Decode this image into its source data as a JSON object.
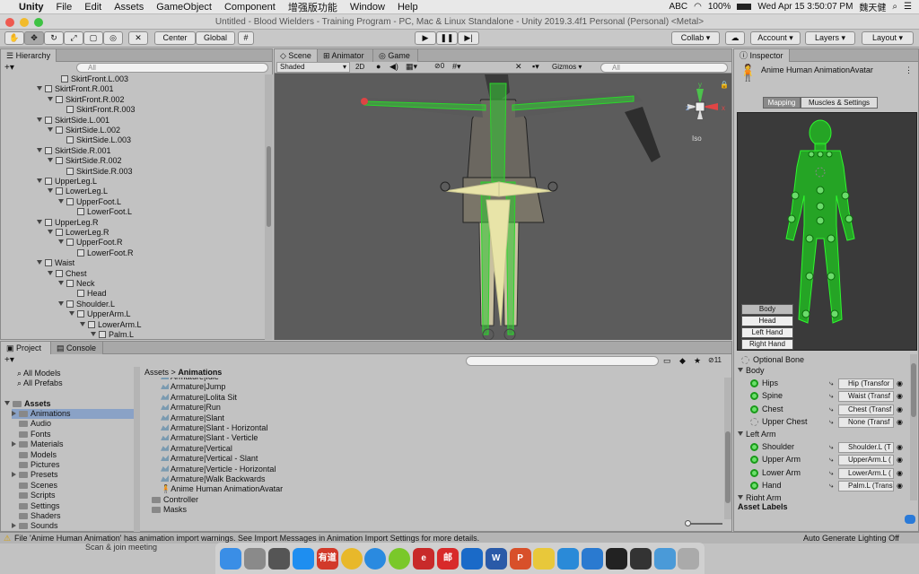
{
  "macbar": {
    "apple": "",
    "app": "Unity",
    "menus": [
      "File",
      "Edit",
      "Assets",
      "GameObject",
      "Component",
      "增强版功能",
      "Window",
      "Help"
    ],
    "abc": "ABC",
    "battery": "100%",
    "clock": "Wed Apr 15  3:50:07 PM",
    "user": "魏天健"
  },
  "titlebar": {
    "text": "Untitled - Blood Wielders - Training Program - PC, Mac & Linux Standalone - Unity 2019.3.4f1 Personal (Personal) <Metal>"
  },
  "toolbar": {
    "center": "Center",
    "global": "Global",
    "collab": "Collab ▾",
    "account": "Account ▾",
    "layers": "Layers ▾",
    "layout": "Layout ▾"
  },
  "hierarchy": {
    "tab": "Hierarchy",
    "create": "+▾",
    "search": "All",
    "rows": [
      {
        "label": "SkirtFront.L.003",
        "indent": 10,
        "arrow": false
      },
      {
        "label": "SkirtFront.R.001",
        "indent": 7,
        "arrow": true
      },
      {
        "label": "SkirtFront.R.002",
        "indent": 9,
        "arrow": true
      },
      {
        "label": "SkirtFront.R.003",
        "indent": 11,
        "arrow": false
      },
      {
        "label": "SkirtSide.L.001",
        "indent": 7,
        "arrow": true
      },
      {
        "label": "SkirtSide.L.002",
        "indent": 9,
        "arrow": true
      },
      {
        "label": "SkirtSide.L.003",
        "indent": 11,
        "arrow": false
      },
      {
        "label": "SkirtSide.R.001",
        "indent": 7,
        "arrow": true
      },
      {
        "label": "SkirtSide.R.002",
        "indent": 9,
        "arrow": true
      },
      {
        "label": "SkirtSide.R.003",
        "indent": 11,
        "arrow": false
      },
      {
        "label": "UpperLeg.L",
        "indent": 7,
        "arrow": true
      },
      {
        "label": "LowerLeg.L",
        "indent": 9,
        "arrow": true
      },
      {
        "label": "UpperFoot.L",
        "indent": 11,
        "arrow": true
      },
      {
        "label": "LowerFoot.L",
        "indent": 13,
        "arrow": false
      },
      {
        "label": "UpperLeg.R",
        "indent": 7,
        "arrow": true
      },
      {
        "label": "LowerLeg.R",
        "indent": 9,
        "arrow": true
      },
      {
        "label": "UpperFoot.R",
        "indent": 11,
        "arrow": true
      },
      {
        "label": "LowerFoot.R",
        "indent": 13,
        "arrow": false
      },
      {
        "label": "Waist",
        "indent": 7,
        "arrow": true
      },
      {
        "label": "Chest",
        "indent": 9,
        "arrow": true
      },
      {
        "label": "Neck",
        "indent": 11,
        "arrow": true
      },
      {
        "label": "Head",
        "indent": 13,
        "arrow": false
      },
      {
        "label": "Shoulder.L",
        "indent": 11,
        "arrow": true
      },
      {
        "label": "UpperArm.L",
        "indent": 13,
        "arrow": true
      },
      {
        "label": "LowerArm.L",
        "indent": 15,
        "arrow": true
      },
      {
        "label": "Palm.L",
        "indent": 17,
        "arrow": true
      }
    ]
  },
  "scene": {
    "tabs": [
      "Scene",
      "Animator",
      "Game"
    ],
    "shading": "Shaded",
    "mode2d": "2D",
    "layers_count": "0",
    "gizmos": "Gizmos",
    "search": "All",
    "iso": "Iso",
    "axis_y": "y",
    "axis_x": "x",
    "axis_z": "z"
  },
  "inspector": {
    "tab": "Inspector",
    "title": "Anime Human AnimationAvatar",
    "tabs": [
      "Mapping",
      "Muscles & Settings"
    ],
    "body_buttons": [
      "Body",
      "Head",
      "Left Hand",
      "Right Hand"
    ],
    "optional": "Optional Bone",
    "sections": [
      {
        "kind": "header",
        "label": "Body"
      },
      {
        "kind": "bone",
        "label": "Hips",
        "value": "Hip (Transfor",
        "filled": true
      },
      {
        "kind": "bone",
        "label": "Spine",
        "value": "Waist (Transf",
        "filled": true
      },
      {
        "kind": "bone",
        "label": "Chest",
        "value": "Chest (Transf",
        "filled": true
      },
      {
        "kind": "bone",
        "label": "Upper Chest",
        "value": "None (Transf",
        "filled": false
      },
      {
        "kind": "header",
        "label": "Left Arm"
      },
      {
        "kind": "bone",
        "label": "Shoulder",
        "value": "Shoulder.L (T",
        "filled": true
      },
      {
        "kind": "bone",
        "label": "Upper Arm",
        "value": "UpperArm.L (",
        "filled": true
      },
      {
        "kind": "bone",
        "label": "Lower Arm",
        "value": "LowerArm.L (",
        "filled": true
      },
      {
        "kind": "bone",
        "label": "Hand",
        "value": "Palm.L (Trans",
        "filled": true
      },
      {
        "kind": "header",
        "label": "Right Arm"
      }
    ],
    "asset_labels": "Asset Labels"
  },
  "project": {
    "tabs": [
      "Project",
      "Console"
    ],
    "create": "+▾",
    "favorites": [
      "All Models",
      "All Prefabs"
    ],
    "assets_root": "Assets",
    "folders": [
      "Animations",
      "Audio",
      "Fonts",
      "Materials",
      "Models",
      "Pictures",
      "Presets",
      "Scenes",
      "Scripts",
      "Settings",
      "Shaders",
      "Sounds"
    ],
    "folders_arrow": [
      true,
      false,
      false,
      true,
      false,
      false,
      true,
      false,
      false,
      false,
      false,
      true
    ],
    "breadcrumb_root": "Assets",
    "breadcrumb_sep": ">",
    "breadcrumb_current": "Animations",
    "hidden_count": "11",
    "files": [
      {
        "prefix": "Armature",
        "name": "Idle"
      },
      {
        "prefix": "Armature",
        "name": "Jump"
      },
      {
        "prefix": "Armature",
        "name": "Lolita Sit"
      },
      {
        "prefix": "Armature",
        "name": "Run"
      },
      {
        "prefix": "Armature",
        "name": "Slant"
      },
      {
        "prefix": "Armature",
        "name": "Slant - Horizontal"
      },
      {
        "prefix": "Armature",
        "name": "Slant - Verticle"
      },
      {
        "prefix": "Armature",
        "name": "Vertical"
      },
      {
        "prefix": "Armature",
        "name": "Vertical - Slant"
      },
      {
        "prefix": "Armature",
        "name": "Verticle - Horizontal"
      },
      {
        "prefix": "Armature",
        "name": "Walk Backwards"
      },
      {
        "prefix": "",
        "name": "Anime Human AnimationAvatar"
      },
      {
        "prefix": "",
        "name": "Controller"
      },
      {
        "prefix": "",
        "name": "Masks"
      }
    ]
  },
  "status": {
    "warning": "File 'Anime Human Animation' has animation import warnings. See Import Messages in Animation Import Settings for more details.",
    "right": "Auto Generate Lighting Off",
    "behind": "Scan & join meeting"
  },
  "dock": {
    "apps": [
      {
        "name": "finder",
        "color": "#3a8ee6"
      },
      {
        "name": "system-preferences",
        "color": "#8a8a8a"
      },
      {
        "name": "launchpad",
        "color": "#555"
      },
      {
        "name": "app-store",
        "color": "#1e8ef0"
      },
      {
        "name": "youdao",
        "color": "#d23a2a"
      },
      {
        "name": "chrome",
        "color": "#e8b82a"
      },
      {
        "name": "safari",
        "color": "#2a8ae0"
      },
      {
        "name": "quark",
        "color": "#7ac82a"
      },
      {
        "name": "evernote",
        "color": "#c82a2a"
      },
      {
        "name": "mail",
        "color": "#d82a2a"
      },
      {
        "name": "outlook",
        "color": "#1a6ac8"
      },
      {
        "name": "word",
        "color": "#2a5aa8"
      },
      {
        "name": "powerpoint",
        "color": "#d8502a"
      },
      {
        "name": "notes",
        "color": "#e8c83a"
      },
      {
        "name": "unity-hub",
        "color": "#2a8ad8"
      },
      {
        "name": "vscode",
        "color": "#2a7ad0"
      },
      {
        "name": "unity",
        "color": "#222"
      },
      {
        "name": "unity-2",
        "color": "#333"
      },
      {
        "name": "downloads",
        "color": "#4a9ad8"
      },
      {
        "name": "trash",
        "color": "#aaa"
      }
    ],
    "labels": {
      "youdao": "有道",
      "evernote": "e",
      "mail": "邮",
      "word": "W",
      "powerpoint": "P"
    }
  }
}
